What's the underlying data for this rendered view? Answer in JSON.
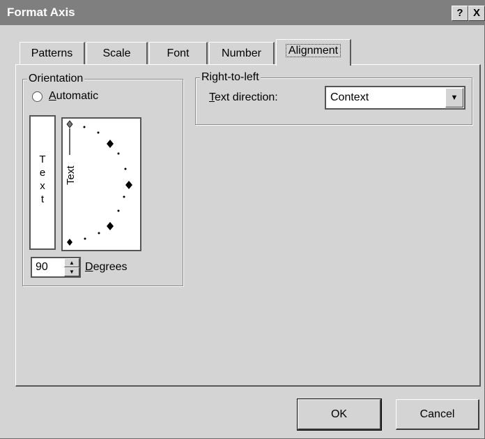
{
  "window": {
    "title": "Format Axis"
  },
  "titlebar": {
    "help_label": "?",
    "close_label": "X"
  },
  "tabs": [
    {
      "label": "Patterns"
    },
    {
      "label": "Scale"
    },
    {
      "label": "Font"
    },
    {
      "label": "Number"
    },
    {
      "label": "Alignment",
      "active": true
    }
  ],
  "orientation": {
    "legend": "Orientation",
    "automatic_prefix": "",
    "automatic_accel": "A",
    "automatic_rest": "utomatic",
    "vertical_text": [
      "T",
      "e",
      "x",
      "t"
    ],
    "dial_text": "Text",
    "degrees_value": "90",
    "degrees_accel": "D",
    "degrees_rest": "egrees"
  },
  "rtl": {
    "legend": "Right-to-left",
    "direction_accel": "T",
    "direction_rest": "ext direction:",
    "direction_value": "Context"
  },
  "buttons": {
    "ok": "OK",
    "cancel": "Cancel"
  },
  "colors": {
    "titlebar": "#7f7f7f",
    "dialog": "#d4d4d4"
  }
}
